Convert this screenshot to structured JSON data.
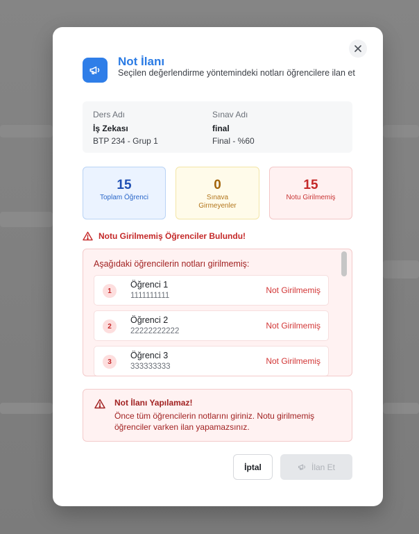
{
  "modal": {
    "title": "Not İlanı",
    "subtitle": "Seçilen değerlendirme yöntemindeki notları öğrencilere ilan et",
    "header_icon": "megaphone-icon",
    "close_icon": "close-icon"
  },
  "course": {
    "course_label": "Ders Adı",
    "course_name": "İş Zekası",
    "course_code": "BTP 234 - Grup 1",
    "exam_label": "Sınav Adı",
    "exam_name": "final",
    "exam_detail": "Final - %60"
  },
  "stats": {
    "total_value": "15",
    "total_label": "Toplam Öğrenci",
    "absent_value": "0",
    "absent_label": "Sınava Girmeyenler",
    "missing_value": "15",
    "missing_label": "Notu Girilmemiş"
  },
  "warning": {
    "heading": "Notu Girilmemiş Öğrenciler Bulundu!",
    "intro": "Aşağıdaki öğrencilerin notları girilmemiş:",
    "students": [
      {
        "index": "1",
        "name": "Öğrenci 1",
        "id": "1111111111",
        "status": "Not Girilmemiş"
      },
      {
        "index": "2",
        "name": "Öğrenci 2",
        "id": "22222222222",
        "status": "Not Girilmemiş"
      },
      {
        "index": "3",
        "name": "Öğrenci 3",
        "id": "333333333",
        "status": "Not Girilmemiş"
      }
    ]
  },
  "error": {
    "title": "Not İlanı Yapılamaz!",
    "text": "Önce tüm öğrencilerin notlarını giriniz. Notu girilmemiş öğrenciler varken ilan yapamazsınız."
  },
  "actions": {
    "cancel_label": "İptal",
    "announce_label": "İlan Et"
  },
  "colors": {
    "accent": "#2f7ee8",
    "danger": "#c42828",
    "warning": "#a2640a"
  }
}
